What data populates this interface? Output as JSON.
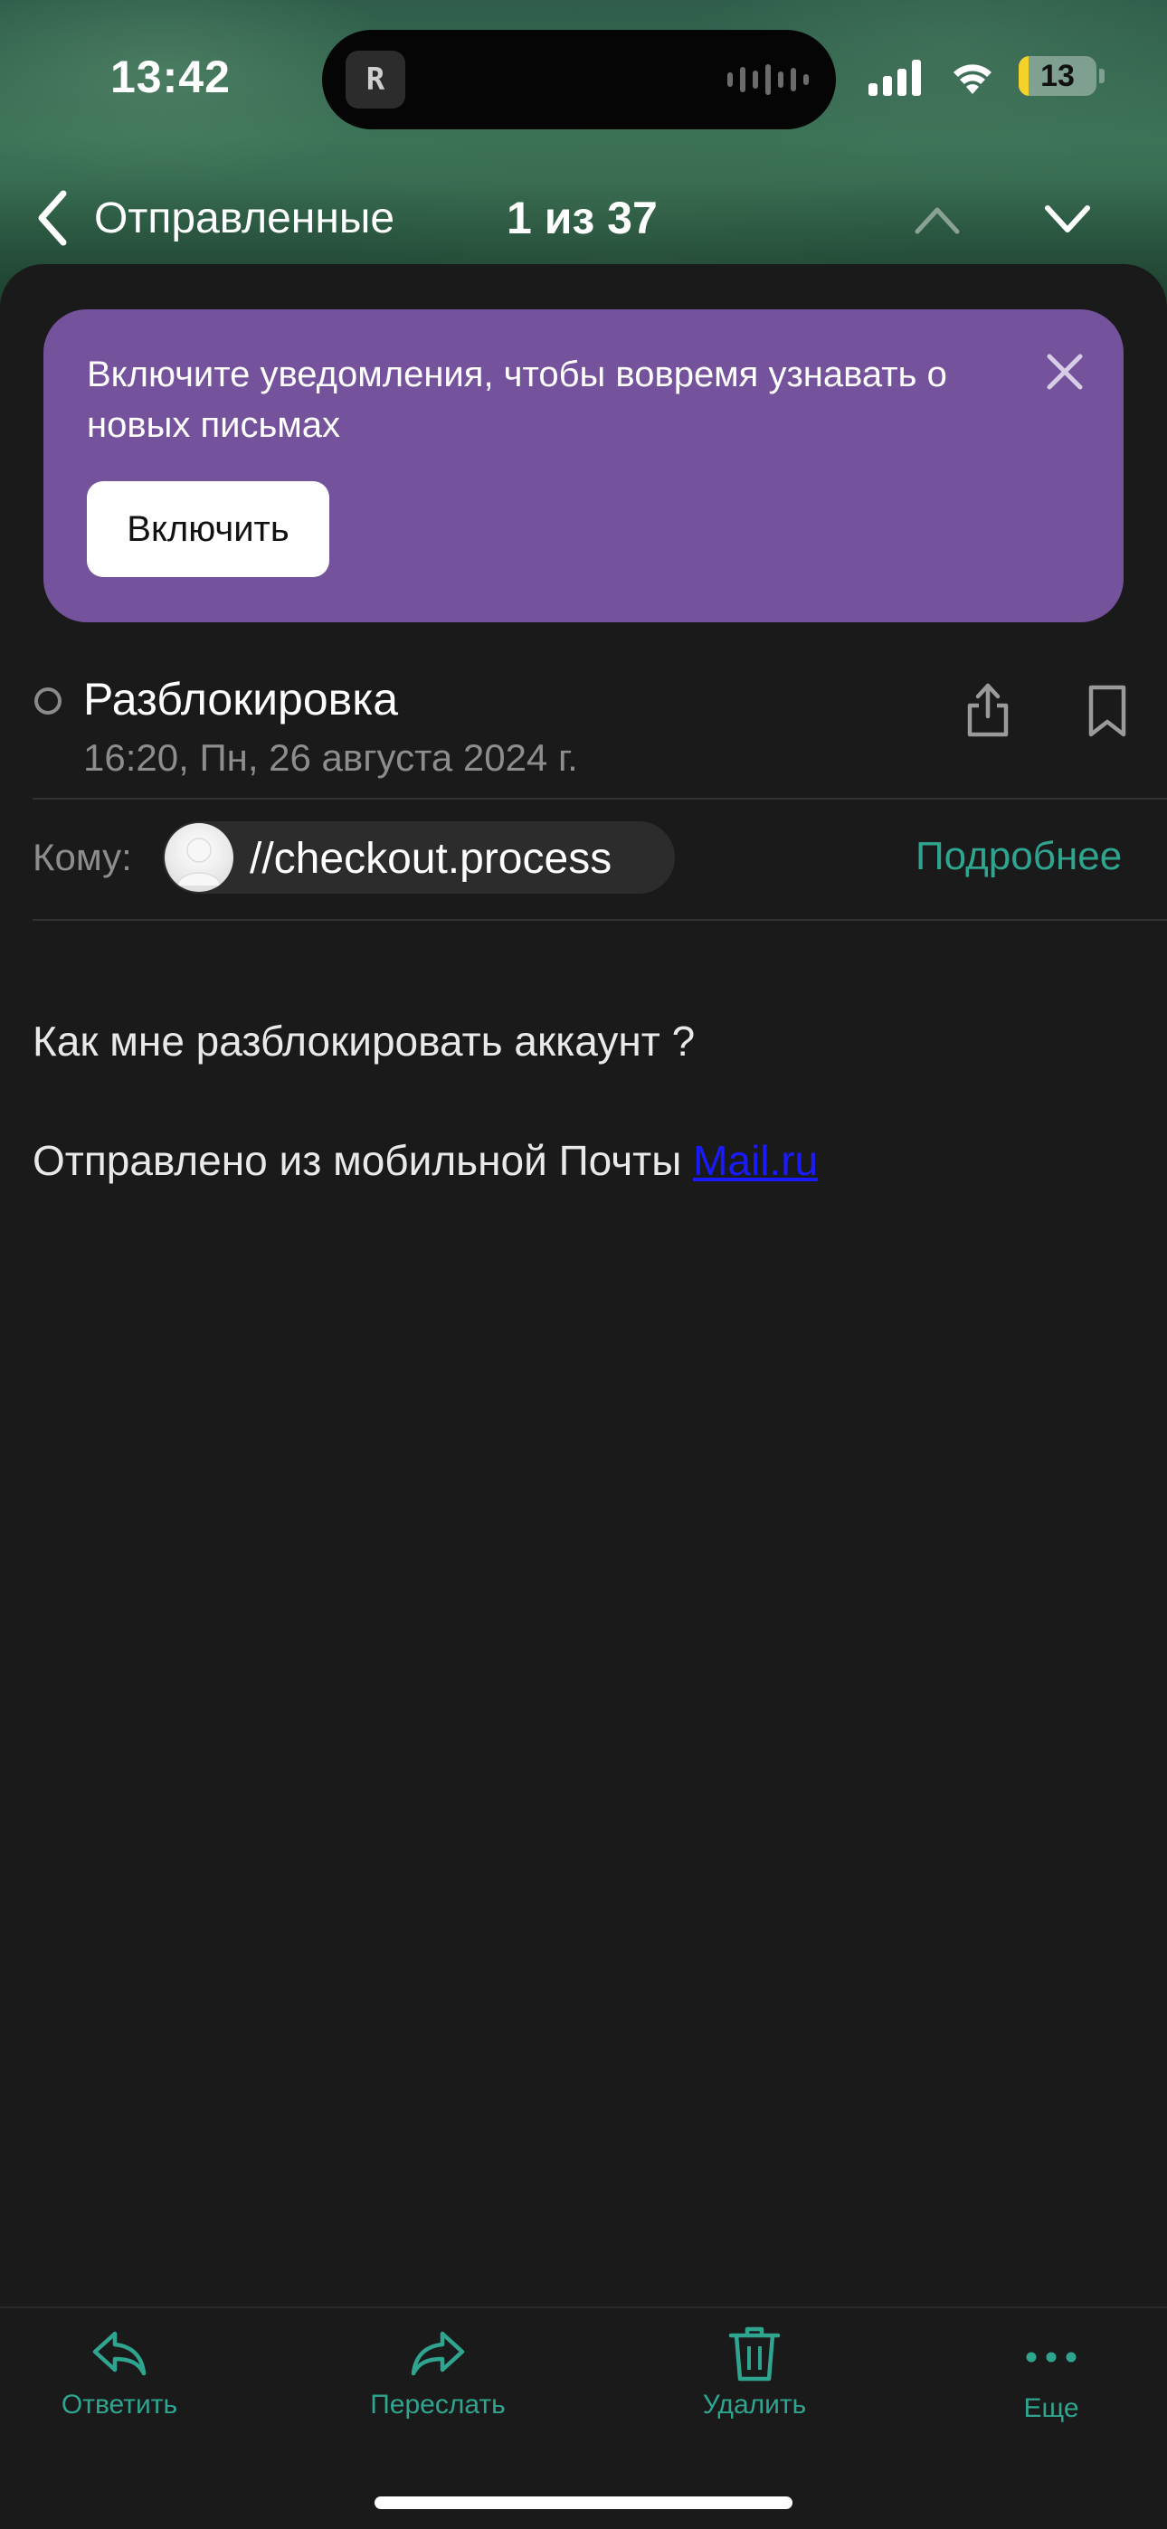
{
  "status_bar": {
    "time": "13:42",
    "island_app_glyph": "R",
    "battery_level": "13",
    "battery_fraction": 0.13
  },
  "nav": {
    "back_label": "Отправленные",
    "counter": "1 из 37"
  },
  "banner": {
    "text": "Включите уведомления, чтобы вовремя узнавать о новых письмах",
    "button_label": "Включить"
  },
  "message": {
    "subject": "Разблокировка",
    "date": "16:20, Пн, 26 августа 2024 г.",
    "to_label": "Кому:",
    "recipient": "//checkout.process",
    "details_label": "Подробнее",
    "body_line1": "Как мне разблокировать аккаунт ?",
    "signature_prefix": "Отправлено из мобильной Почты ",
    "signature_link": "Mail.ru"
  },
  "toolbar": {
    "reply_label": "Ответить",
    "forward_label": "Переслать",
    "delete_label": "Удалить",
    "more_label": "Еще"
  },
  "colors": {
    "accent": "#2fa58f",
    "banner_bg": "#74529c",
    "background": "#1a1a1a",
    "link": "#1a1aff"
  },
  "icons": [
    "back-chevron-icon",
    "chevron-up-icon",
    "chevron-down-icon",
    "close-icon",
    "share-icon",
    "bookmark-icon",
    "avatar-icon",
    "reply-icon",
    "forward-icon",
    "trash-icon",
    "more-icon",
    "signal-icon",
    "wifi-icon",
    "battery-icon"
  ]
}
